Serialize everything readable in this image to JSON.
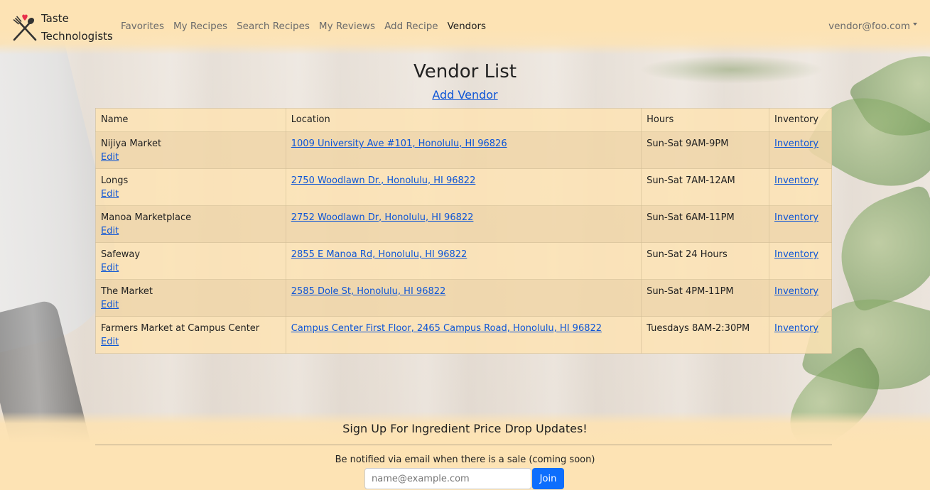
{
  "brand": {
    "line1": "Taste",
    "line2": "Technologists"
  },
  "nav": {
    "links": [
      {
        "label": "Favorites"
      },
      {
        "label": "My Recipes"
      },
      {
        "label": "Search Recipes"
      },
      {
        "label": "My Reviews"
      },
      {
        "label": "Add Recipe"
      },
      {
        "label": "Vendors"
      }
    ],
    "active_index": 5,
    "user": "vendor@foo.com"
  },
  "main": {
    "title": "Vendor List",
    "add_vendor_label": "Add Vendor",
    "table": {
      "headers": [
        "Name",
        "Location",
        "Hours",
        "Inventory"
      ],
      "rows": [
        {
          "name": "Nijiya Market",
          "edit": "Edit",
          "location": "1009 University Ave #101, Honolulu, HI 96826",
          "hours": "Sun-Sat 9AM-9PM",
          "inventory": "Inventory"
        },
        {
          "name": "Longs",
          "edit": "Edit",
          "location": "2750 Woodlawn Dr., Honolulu, HI 96822",
          "hours": "Sun-Sat 7AM-12AM",
          "inventory": "Inventory"
        },
        {
          "name": "Manoa Marketplace",
          "edit": "Edit",
          "location": "2752 Woodlawn Dr, Honolulu, HI 96822",
          "hours": "Sun-Sat 6AM-11PM",
          "inventory": "Inventory"
        },
        {
          "name": "Safeway",
          "edit": "Edit",
          "location": "2855 E Manoa Rd, Honolulu, HI 96822",
          "hours": "Sun-Sat 24 Hours",
          "inventory": "Inventory"
        },
        {
          "name": "The Market",
          "edit": "Edit",
          "location": "2585 Dole St, Honolulu, HI 96822",
          "hours": "Sun-Sat 4PM-11PM",
          "inventory": "Inventory"
        },
        {
          "name": "Farmers Market at Campus Center",
          "edit": "Edit",
          "location": "Campus Center First Floor, 2465 Campus Road, Honolulu, HI 96822",
          "hours": "Tuesdays 8AM-2:30PM",
          "inventory": "Inventory"
        }
      ]
    }
  },
  "footer": {
    "title": "Sign Up For Ingredient Price Drop Updates!",
    "subtitle": "Be notified via email when there is a sale (coming soon)",
    "email_placeholder": "name@example.com",
    "join_label": "Join"
  },
  "colors": {
    "navbar_bg": "#fde3b4",
    "link": "#0d55d6",
    "join_button": "#0d6efd",
    "row_odd": "#f0d6a8",
    "row_even": "#fde3b4",
    "heart": "#e8304a"
  },
  "icons": {
    "brand_logo": "fork-spoon-heart-icon",
    "user_menu": "caret-down-icon"
  }
}
